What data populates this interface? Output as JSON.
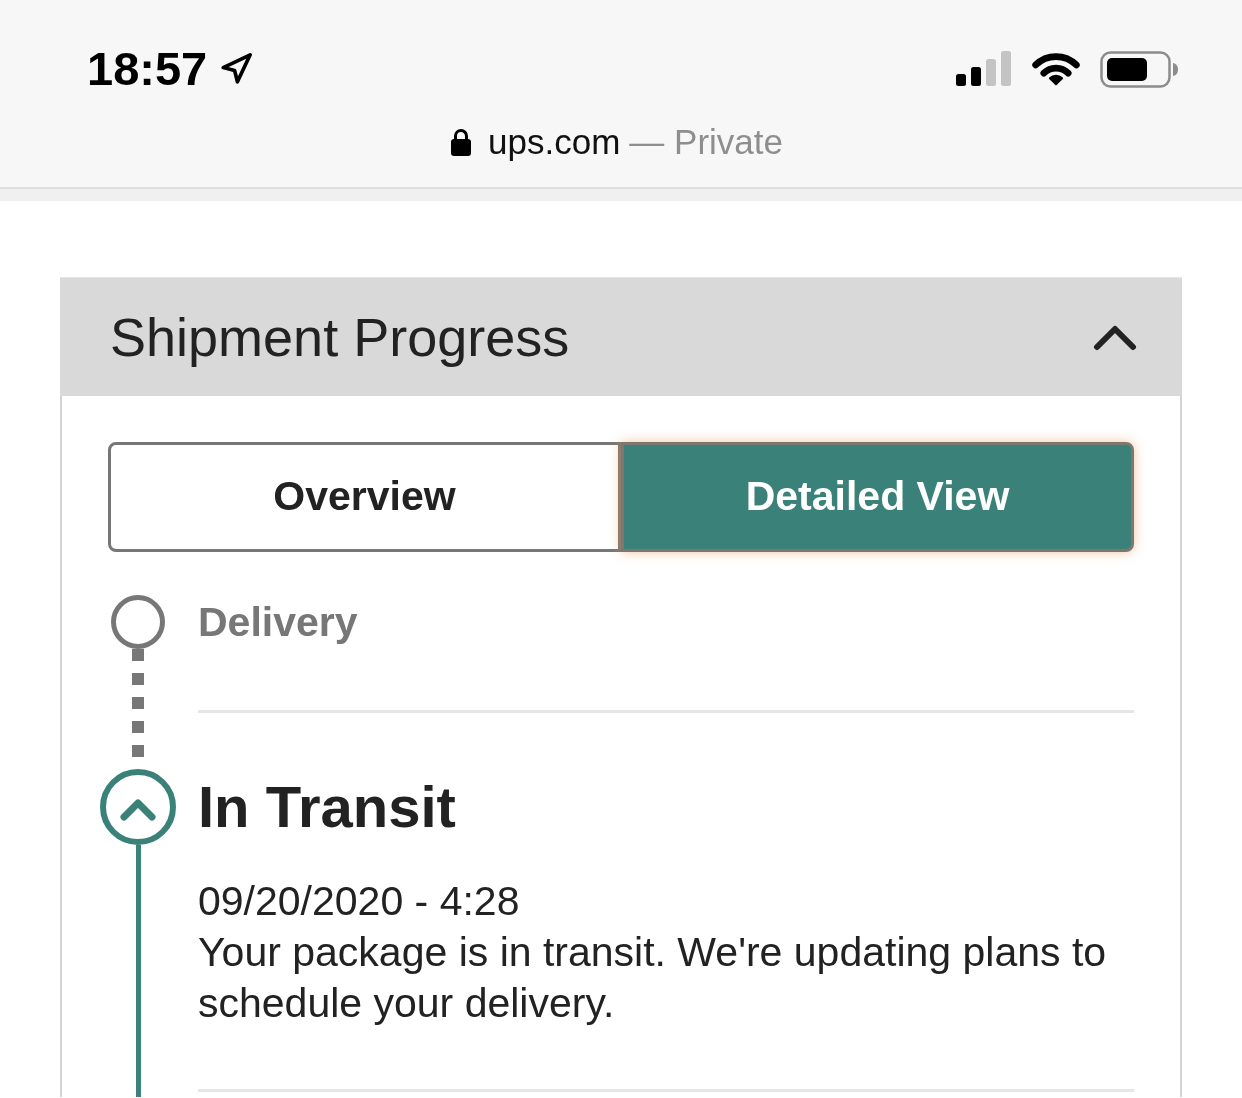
{
  "status_bar": {
    "time": "18:57",
    "url": "ups.com",
    "url_note": "— Private"
  },
  "panel": {
    "title": "Shipment Progress",
    "expanded": true
  },
  "view_tabs": [
    {
      "label": "Overview",
      "selected": false
    },
    {
      "label": "Detailed View",
      "selected": true
    }
  ],
  "timeline": [
    {
      "kind": "pending",
      "title": "Delivery"
    },
    {
      "kind": "current",
      "title": "In Transit",
      "date": "09/20/2020 - 4:28",
      "description": "Your package is in transit. We're updating plans to schedule your delivery."
    }
  ]
}
